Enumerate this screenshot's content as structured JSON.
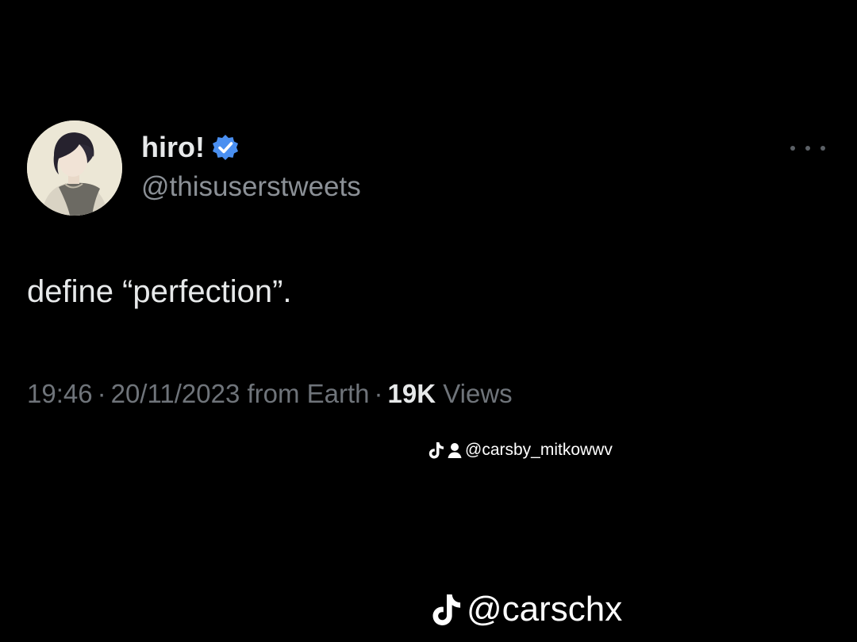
{
  "tweet": {
    "display_name": "hiro!",
    "handle": "@thisuserstweets",
    "text": "define “perfection”.",
    "time": "19:46",
    "date": "20/11/2023",
    "source": "from Earth",
    "views_count": "19K",
    "views_label": "Views",
    "separator": "·",
    "verified_color": "#4a8ff0",
    "icons": {
      "avatar": "profile-photo",
      "verified": "verified-badge-icon",
      "more": "more-options-icon"
    }
  },
  "watermarks": {
    "small": {
      "handle": "@carsby_mitkowwv",
      "icons": [
        "tiktok-icon",
        "person-icon"
      ]
    },
    "large": {
      "handle": "@carschx",
      "icons": [
        "tiktok-icon"
      ]
    }
  },
  "colors": {
    "background": "#000000",
    "primary_text": "#e7e9ea",
    "secondary_text": "#8b9096"
  }
}
